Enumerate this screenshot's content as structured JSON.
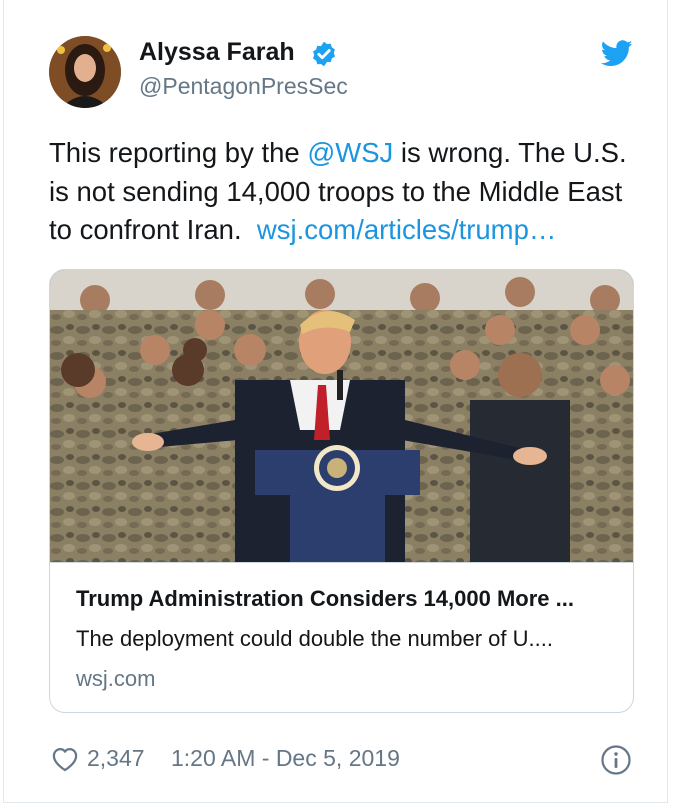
{
  "author": {
    "name": "Alyssa Farah",
    "handle": "@PentagonPresSec",
    "verified": true
  },
  "tweet": {
    "line1_prefix": "This reporting by the ",
    "mention": "@WSJ",
    "line1_suffix": " is wrong. The U.S.",
    "line2": "is not sending 14,000 troops to the Middle East",
    "line3_prefix": "to confront Iran.  ",
    "url": "wsj.com/articles/trump…"
  },
  "card": {
    "title": "Trump Administration Considers 14,000 More ...",
    "description": "The deployment could double the number of U....",
    "domain": "wsj.com"
  },
  "footer": {
    "like_count": "2,347",
    "timestamp": "1:20 AM - Dec 5, 2019"
  },
  "icons": {
    "verified": "verified-badge-icon",
    "brand": "twitter-bird-icon",
    "like": "heart-icon",
    "info": "info-icon"
  },
  "colors": {
    "link": "#1b95e0",
    "secondary_text": "#657786",
    "border": "#ccd6dd"
  }
}
